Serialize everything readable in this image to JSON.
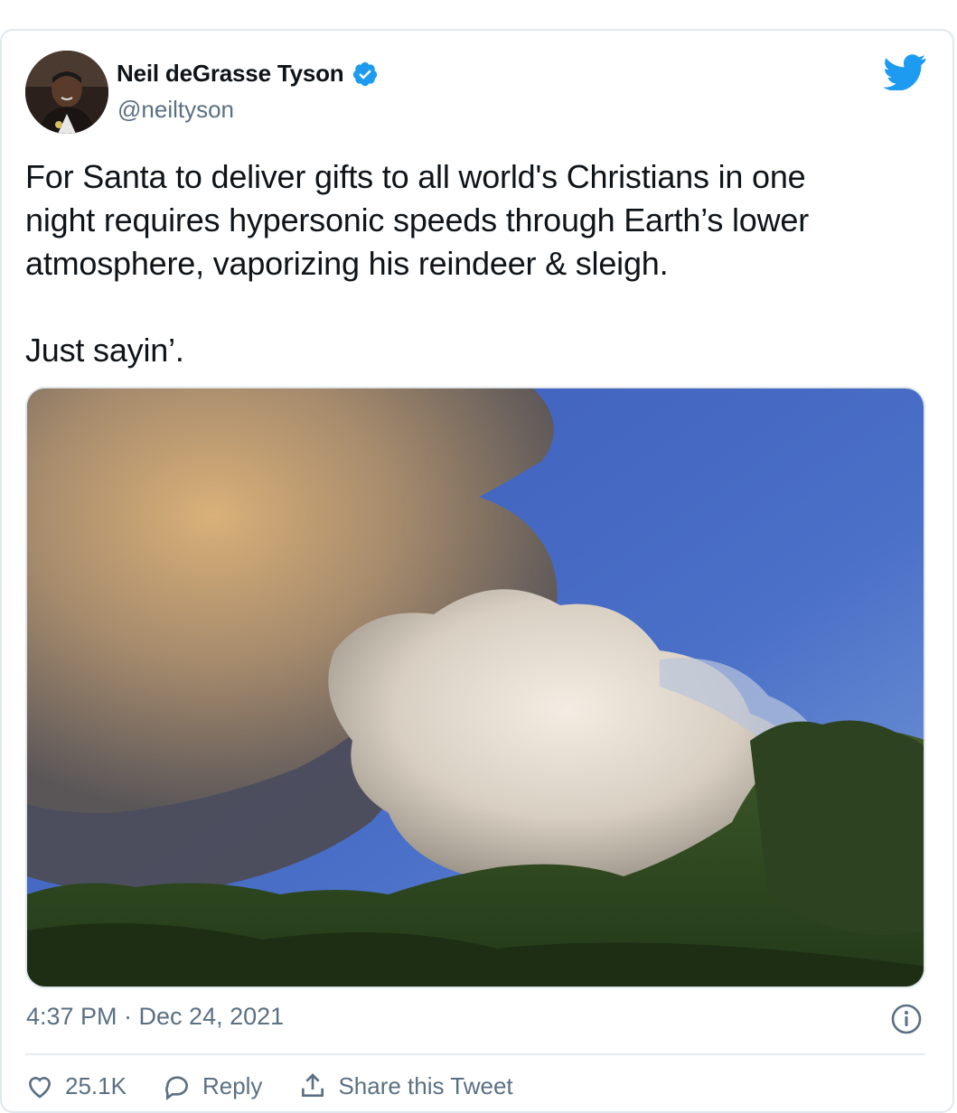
{
  "tweet": {
    "author": {
      "display_name": "Neil deGrasse Tyson",
      "handle": "@neiltyson",
      "verified": true
    },
    "text": "For Santa to deliver gifts to all world's Christians in one\nnight requires hypersonic speeds through Earth’s lower\natmosphere, vaporizing his reindeer & sleigh.\n\nJust sayin’.",
    "media": {
      "description_icon": "photo-smoke-plume"
    },
    "timestamp": "4:37 PM · Dec 24, 2021",
    "actions": {
      "likes_label": "25.1K",
      "reply_label": "Reply",
      "share_label": "Share this Tweet"
    }
  },
  "colors": {
    "twitter_blue": "#1d9bf0",
    "secondary_text": "#5b7083",
    "border": "#e1e8ed"
  },
  "icons": [
    "twitter-bird-icon",
    "verified-badge-icon",
    "info-icon",
    "heart-icon",
    "reply-icon",
    "share-icon"
  ]
}
